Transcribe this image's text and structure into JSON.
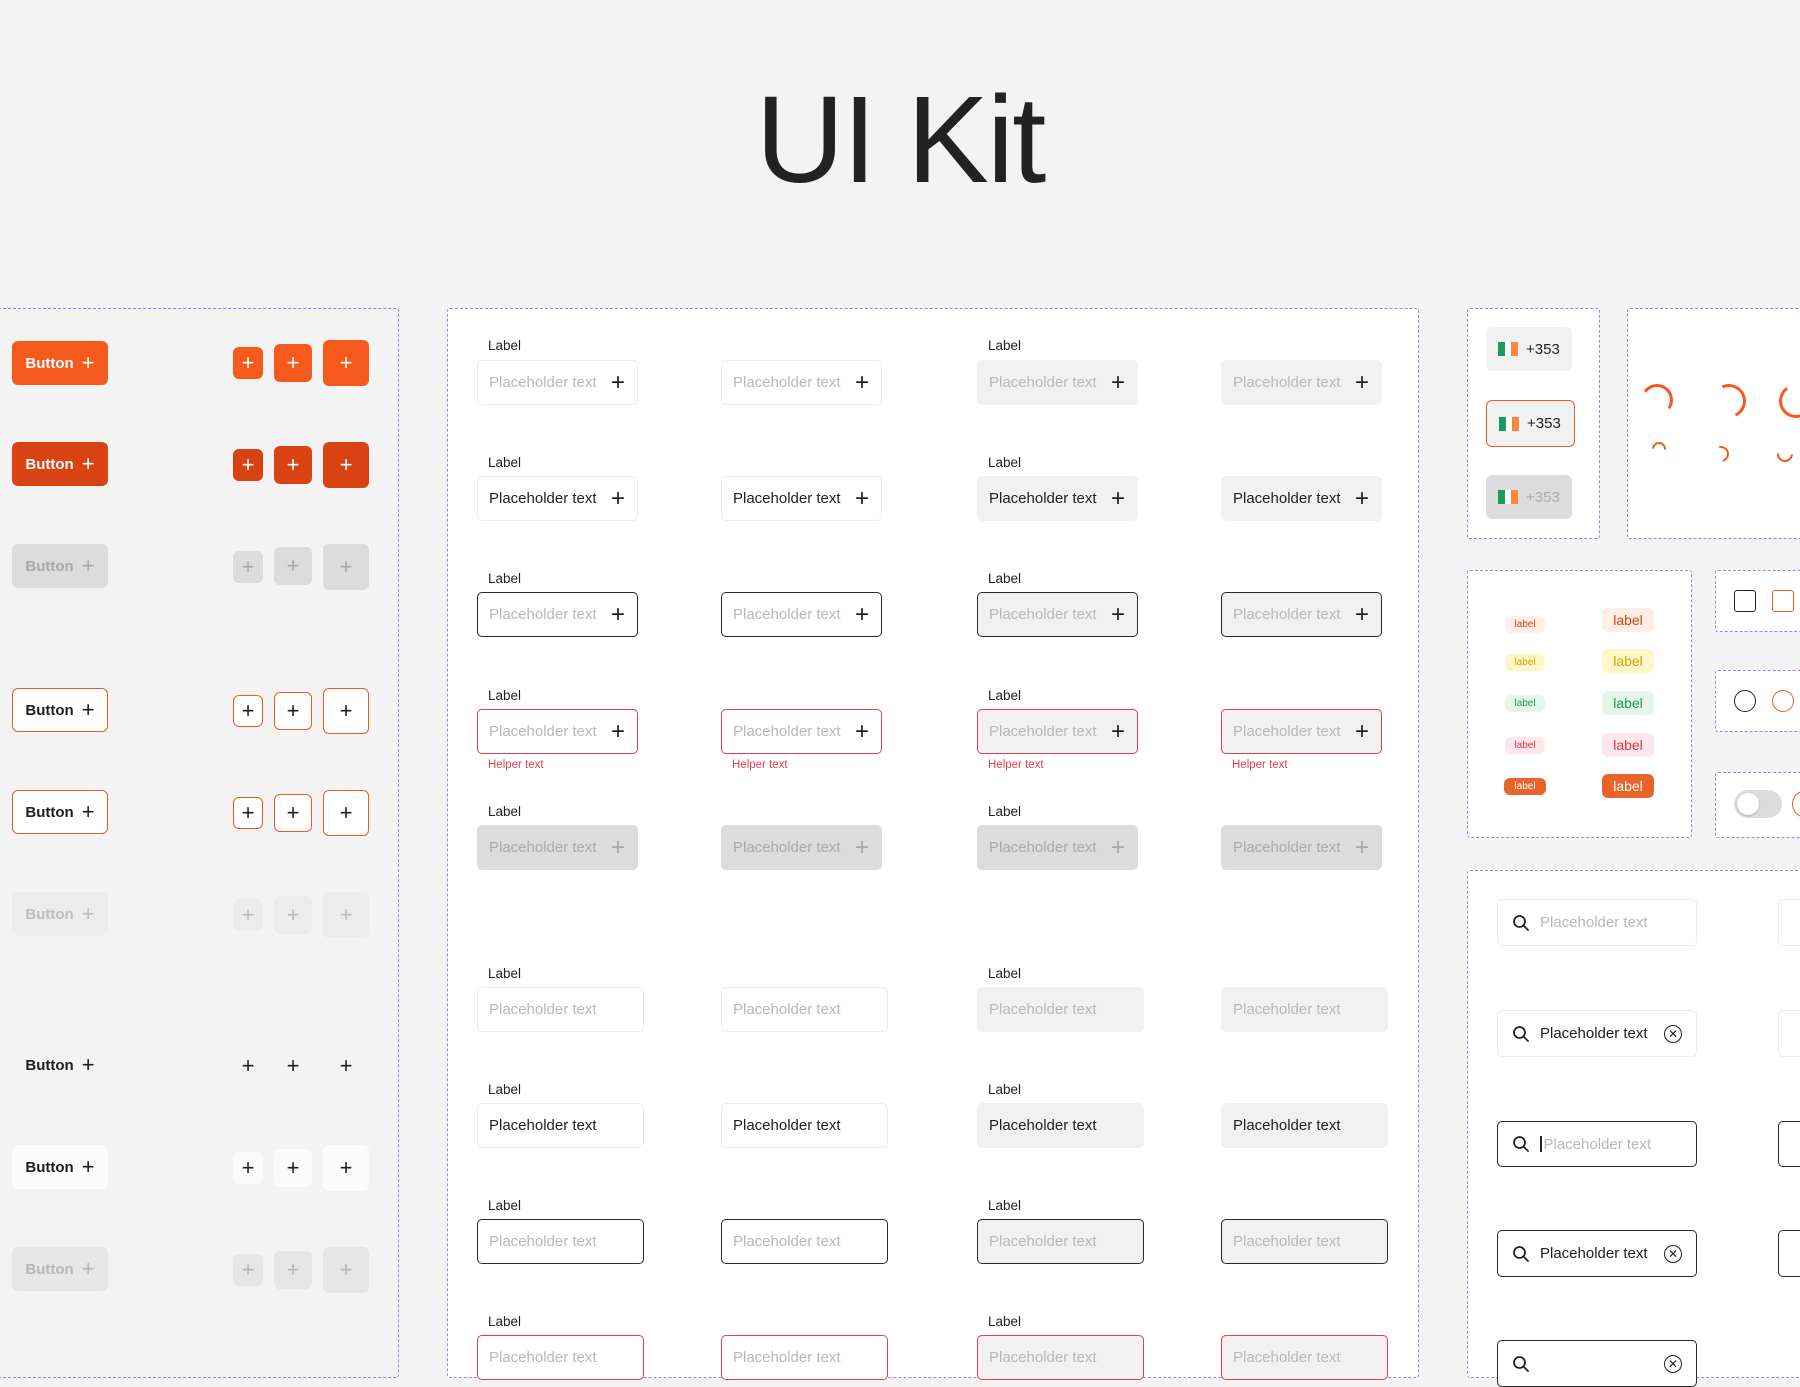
{
  "title": "UI Kit",
  "colors": {
    "accent": "#f55a1c",
    "accent_dark": "#d94213",
    "error": "#e0414f",
    "frame_border": "#a87af0"
  },
  "buttons": {
    "label": "Button"
  },
  "inputs": {
    "label": "Label",
    "placeholder": "Placeholder text",
    "value": "Placeholder text",
    "helper": "Helper text"
  },
  "phone": {
    "code": "+353"
  },
  "badges": {
    "label": "label"
  },
  "search": {
    "placeholder": "Placeholder text",
    "value": "Placeholder text"
  }
}
